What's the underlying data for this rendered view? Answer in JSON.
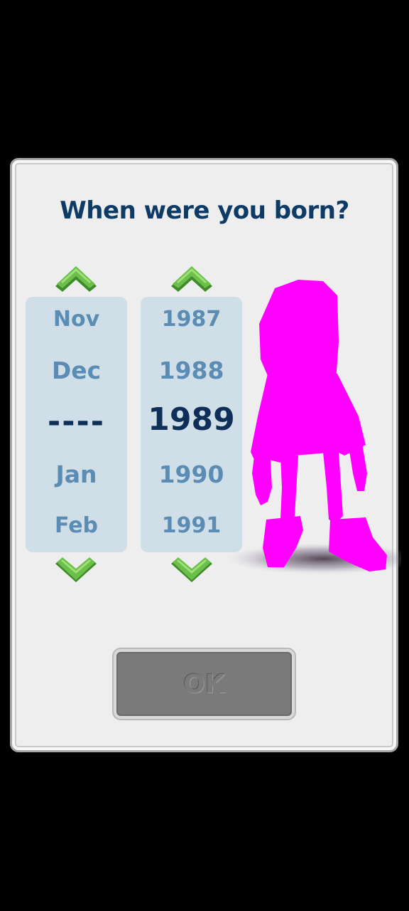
{
  "dialog": {
    "title": "When were you born?"
  },
  "month_picker": {
    "items": [
      "Nov",
      "Dec",
      "----",
      "Jan",
      "Feb"
    ],
    "selected": "----"
  },
  "year_picker": {
    "items": [
      "1987",
      "1988",
      "1989",
      "1990",
      "1991"
    ],
    "selected": "1989"
  },
  "buttons": {
    "ok_label": "OK"
  },
  "icons": {
    "up": "chevron-up-icon",
    "down": "chevron-down-icon"
  },
  "colors": {
    "title": "#0e3a66",
    "arrow_green": "#5aa63a",
    "column_bg": "#d0dee7",
    "item_text": "#5b8db4",
    "selected_text": "#0e2f57",
    "character": "#ff00ff",
    "ok_button": "#7a7a7a"
  }
}
